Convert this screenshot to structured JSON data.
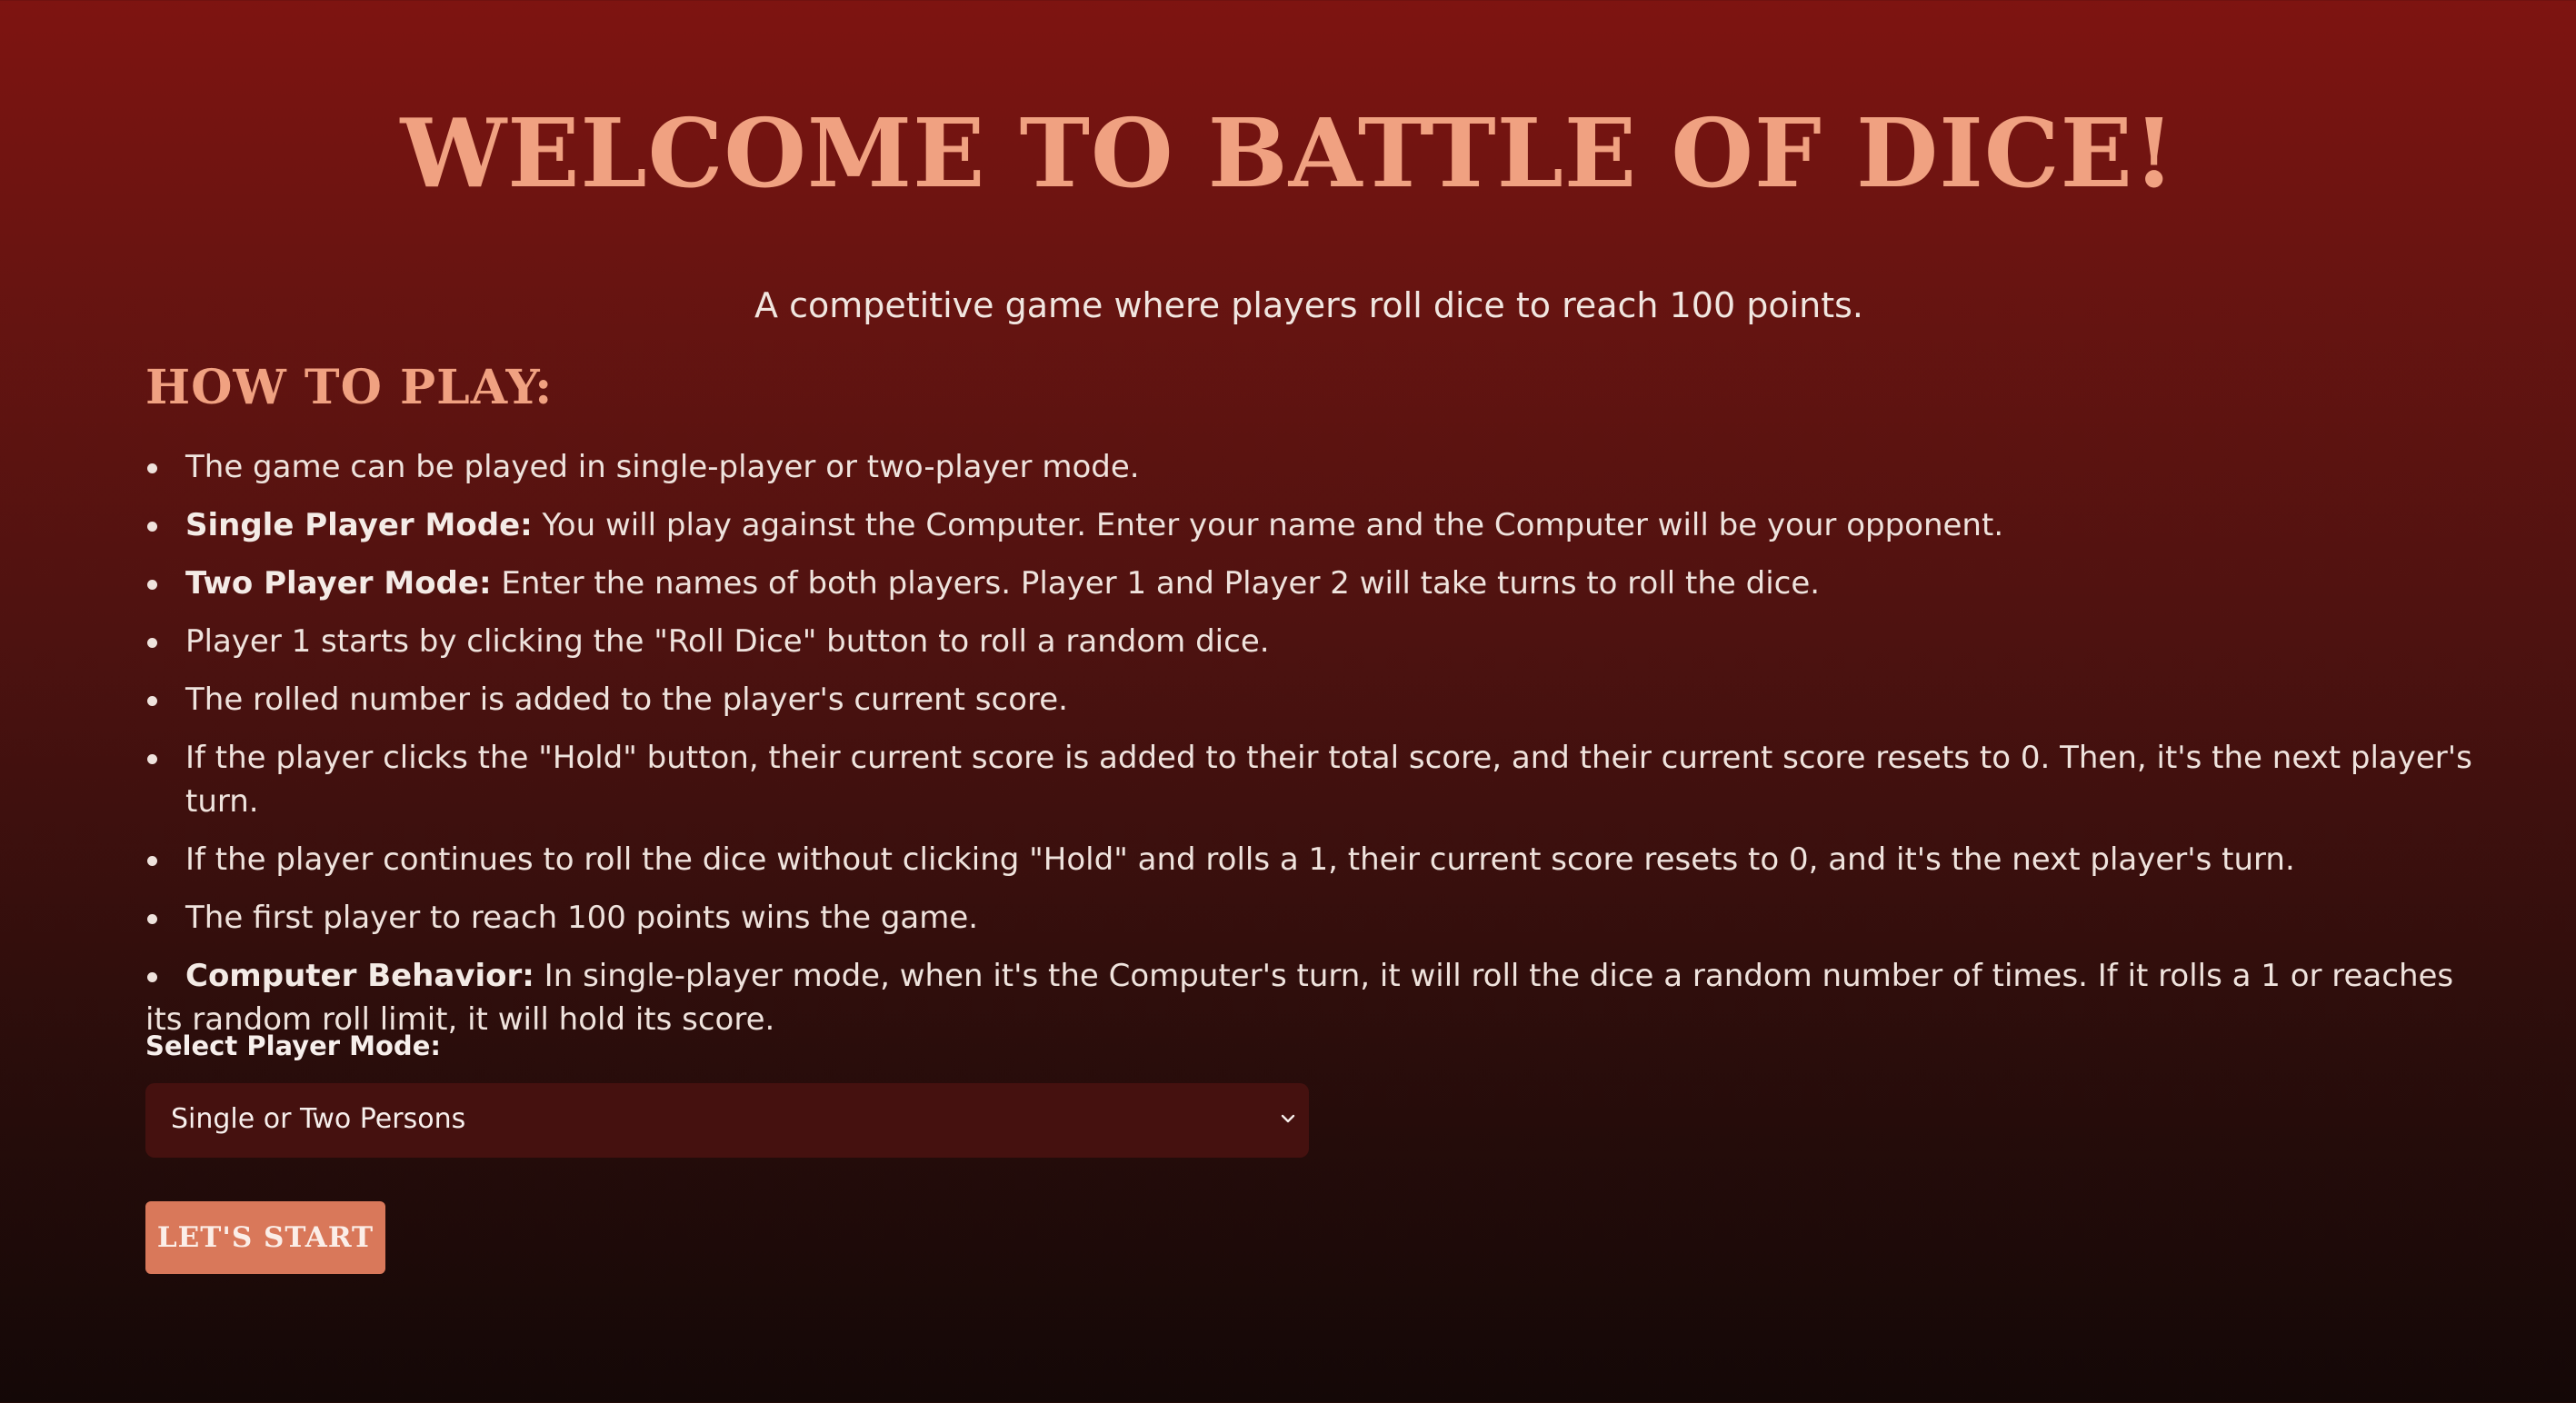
{
  "header": {
    "title": "WELCOME TO BATTLE OF DICE!",
    "subtitle": "A competitive game where players roll dice to reach 100 points."
  },
  "howto": {
    "heading": "HOW TO PLAY:",
    "rules": [
      {
        "bold": "",
        "text": "The game can be played in single-player or two-player mode."
      },
      {
        "bold": "Single Player Mode:",
        "text": " You will play against the Computer. Enter your name and the Computer will be your opponent."
      },
      {
        "bold": "Two Player Mode:",
        "text": " Enter the names of both players. Player 1 and Player 2 will take turns to roll the dice."
      },
      {
        "bold": "",
        "text": "Player 1 starts by clicking the \"Roll Dice\" button to roll a random dice."
      },
      {
        "bold": "",
        "text": "The rolled number is added to the player's current score."
      },
      {
        "bold": "",
        "text": "If the player clicks the \"Hold\" button, their current score is added to their total score, and their current score resets to 0. Then, it's the next player's turn."
      },
      {
        "bold": "",
        "text": "If the player continues to roll the dice without clicking \"Hold\" and rolls a 1, their current score resets to 0, and it's the next player's turn."
      },
      {
        "bold": "",
        "text": "The first player to reach 100 points wins the game."
      },
      {
        "bold": "Computer Behavior:",
        "text": " In single-player mode, when it's the Computer's turn, it will roll the dice a random number of times. If it rolls a 1 or reaches its random roll limit, it will hold its score."
      }
    ]
  },
  "mode": {
    "label": "Select Player Mode:",
    "selected": "Single or Two Persons",
    "icon": "chevron-down-icon"
  },
  "start_button": {
    "label": "LET'S START"
  },
  "colors": {
    "accent": "#f0a181",
    "button": "#d9785a",
    "select_bg": "#45110f",
    "bg_top": "#7e1411",
    "bg_bottom": "#140807"
  }
}
